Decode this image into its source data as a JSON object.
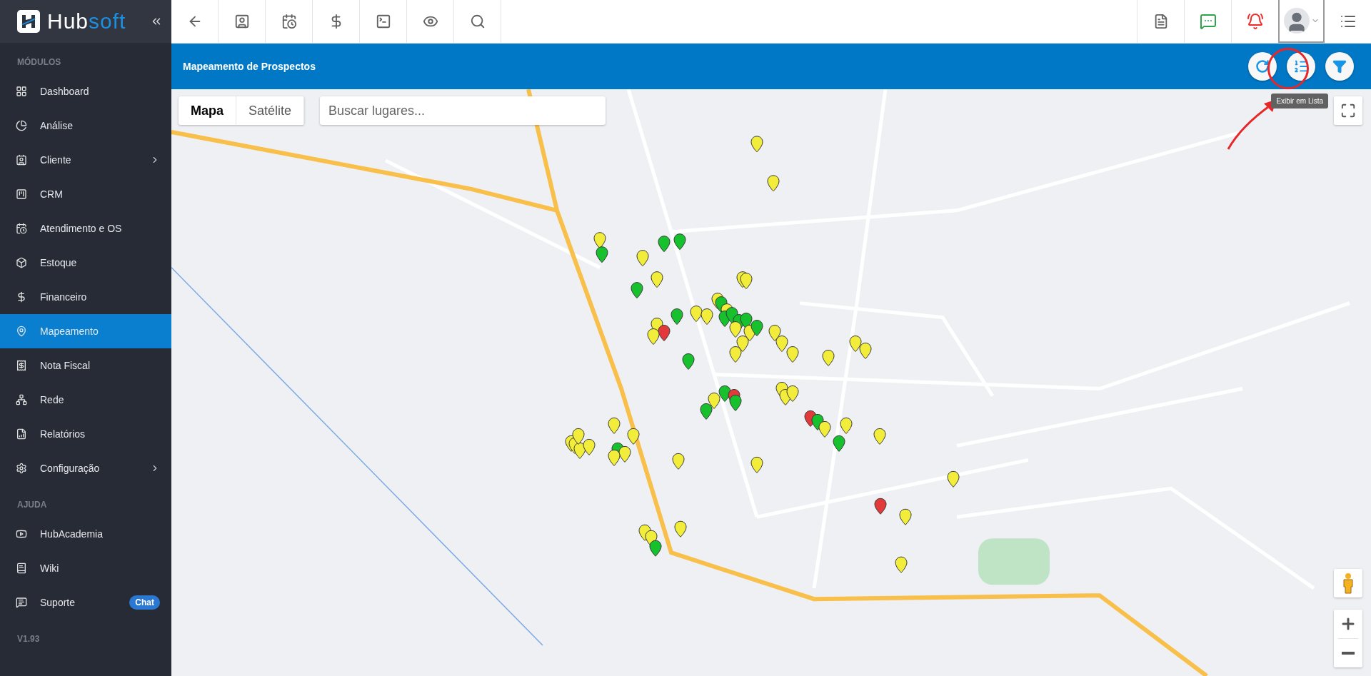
{
  "brand": {
    "name_start": "Hub",
    "name_end": "soft"
  },
  "sidebar": {
    "sections": [
      {
        "title": "MÓDULOS",
        "items": [
          {
            "label": "Dashboard",
            "selected": false,
            "has_submenu": false
          },
          {
            "label": "Análise",
            "selected": false,
            "has_submenu": false
          },
          {
            "label": "Cliente",
            "selected": false,
            "has_submenu": true
          },
          {
            "label": "CRM",
            "selected": false,
            "has_submenu": false
          },
          {
            "label": "Atendimento e OS",
            "selected": false,
            "has_submenu": false
          },
          {
            "label": "Estoque",
            "selected": false,
            "has_submenu": false
          },
          {
            "label": "Financeiro",
            "selected": false,
            "has_submenu": false
          },
          {
            "label": "Mapeamento",
            "selected": true,
            "has_submenu": false
          },
          {
            "label": "Nota Fiscal",
            "selected": false,
            "has_submenu": false
          },
          {
            "label": "Rede",
            "selected": false,
            "has_submenu": false
          },
          {
            "label": "Relatórios",
            "selected": false,
            "has_submenu": false
          },
          {
            "label": "Configuração",
            "selected": false,
            "has_submenu": true
          }
        ]
      },
      {
        "title": "AJUDA",
        "items": [
          {
            "label": "HubAcademia",
            "selected": false,
            "has_submenu": false
          },
          {
            "label": "Wiki",
            "selected": false,
            "has_submenu": false
          },
          {
            "label": "Suporte",
            "selected": false,
            "has_submenu": false,
            "badge": "Chat"
          }
        ]
      }
    ],
    "version": "V1.93"
  },
  "page": {
    "title": "Mapeamento de Prospectos",
    "tooltip": "Exibir em Lista"
  },
  "map": {
    "map_types": [
      {
        "label": "Mapa",
        "selected": true
      },
      {
        "label": "Satélite",
        "selected": false
      }
    ],
    "search": {
      "placeholder": "Buscar lugares..."
    }
  }
}
